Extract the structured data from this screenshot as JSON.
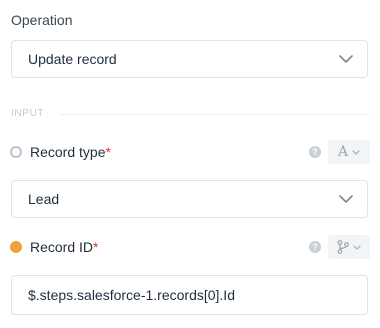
{
  "operation": {
    "label": "Operation",
    "selected": "Update record"
  },
  "section": {
    "label": "INPUT"
  },
  "record_type": {
    "label": "Record type",
    "required_mark": "*",
    "help_glyph": "?",
    "type_glyph": "A",
    "selected": "Lead",
    "status": "unset"
  },
  "record_id": {
    "label": "Record ID",
    "required_mark": "*",
    "help_glyph": "?",
    "value": "$.steps.salesforce-1.records[0].Id",
    "status": "set",
    "status_color": "#f0a03a"
  }
}
